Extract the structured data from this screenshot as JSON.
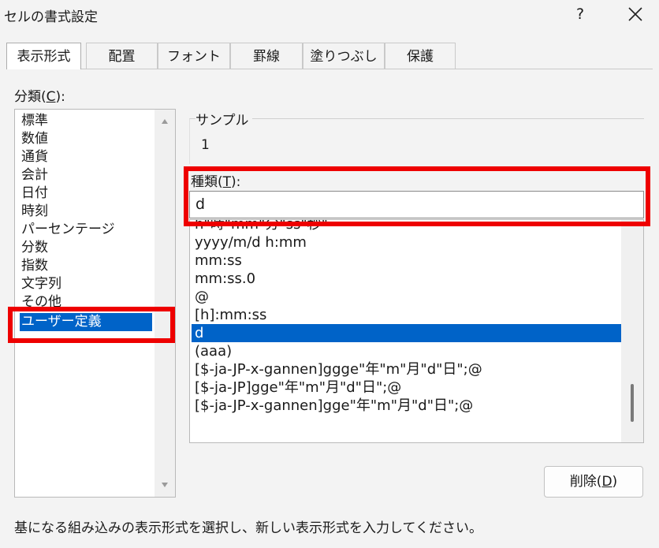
{
  "window": {
    "title": "セルの書式設定",
    "help_label": "?"
  },
  "tabs": [
    {
      "label": "表示形式",
      "active": true
    },
    {
      "label": "配置",
      "active": false
    },
    {
      "label": "フォント",
      "active": false
    },
    {
      "label": "罫線",
      "active": false
    },
    {
      "label": "塗りつぶし",
      "active": false
    },
    {
      "label": "保護",
      "active": false
    }
  ],
  "category": {
    "label_prefix": "分類(",
    "label_key": "C",
    "label_suffix": "):",
    "items": [
      "標準",
      "数値",
      "通貨",
      "会計",
      "日付",
      "時刻",
      "パーセンテージ",
      "分数",
      "指数",
      "文字列",
      "その他",
      "ユーザー定義"
    ],
    "selected": "ユーザー定義"
  },
  "sample": {
    "label": "サンプル",
    "value": "1"
  },
  "type": {
    "label_prefix": "種類(",
    "label_key": "T",
    "label_suffix": "):",
    "value": "d"
  },
  "format_list": {
    "items": [
      "h\"時\"mm\"分\"ss\"秒\"",
      "yyyy/m/d h:mm",
      "mm:ss",
      "mm:ss.0",
      "@",
      "[h]:mm:ss",
      "d",
      "(aaa)",
      "[$-ja-JP-x-gannen]ggge\"年\"m\"月\"d\"日\";@",
      "[$-ja-JP]gge\"年\"m\"月\"d\"日\";@",
      "[$-ja-JP-x-gannen]gge\"年\"m\"月\"d\"日\";@"
    ],
    "selected": "d"
  },
  "delete_button": {
    "label_prefix": "削除(",
    "label_key": "D",
    "label_suffix": ")"
  },
  "hint": "基になる組み込みの表示形式を選択し、新しい表示形式を入力してください。",
  "colors": {
    "selection": "#0063c8",
    "highlight_box": "#ee0000"
  }
}
